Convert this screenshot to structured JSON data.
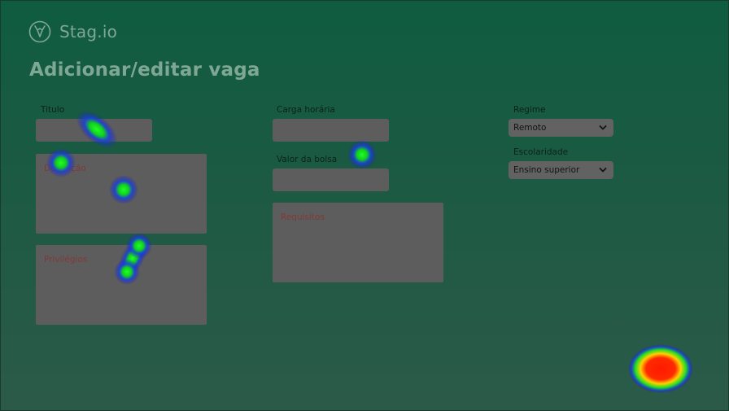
{
  "app": {
    "name": "Stag.io",
    "logo_icon": "stag-logo-icon"
  },
  "page": {
    "title": "Adicionar/editar vaga"
  },
  "form": {
    "titulo": {
      "label": "Titulo",
      "value": ""
    },
    "descricao": {
      "placeholder": "Descrição"
    },
    "privilegios": {
      "placeholder": "Privilégios"
    },
    "carga_horaria": {
      "label": "Carga horária",
      "value": ""
    },
    "valor_bolsa": {
      "label": "Valor da bolsa",
      "value": ""
    },
    "requisitos": {
      "placeholder": "Requisitos"
    },
    "regime": {
      "label": "Regime",
      "selected": "Remoto"
    },
    "escolaridade": {
      "label": "Escolaridade",
      "selected": "Ensino superior"
    }
  },
  "colors": {
    "background_top": "#0f5c40",
    "background_bottom": "#2c5a49",
    "field": "#5d5d5d",
    "placeholder": "#7f3a3a",
    "title": "#7fa894"
  }
}
